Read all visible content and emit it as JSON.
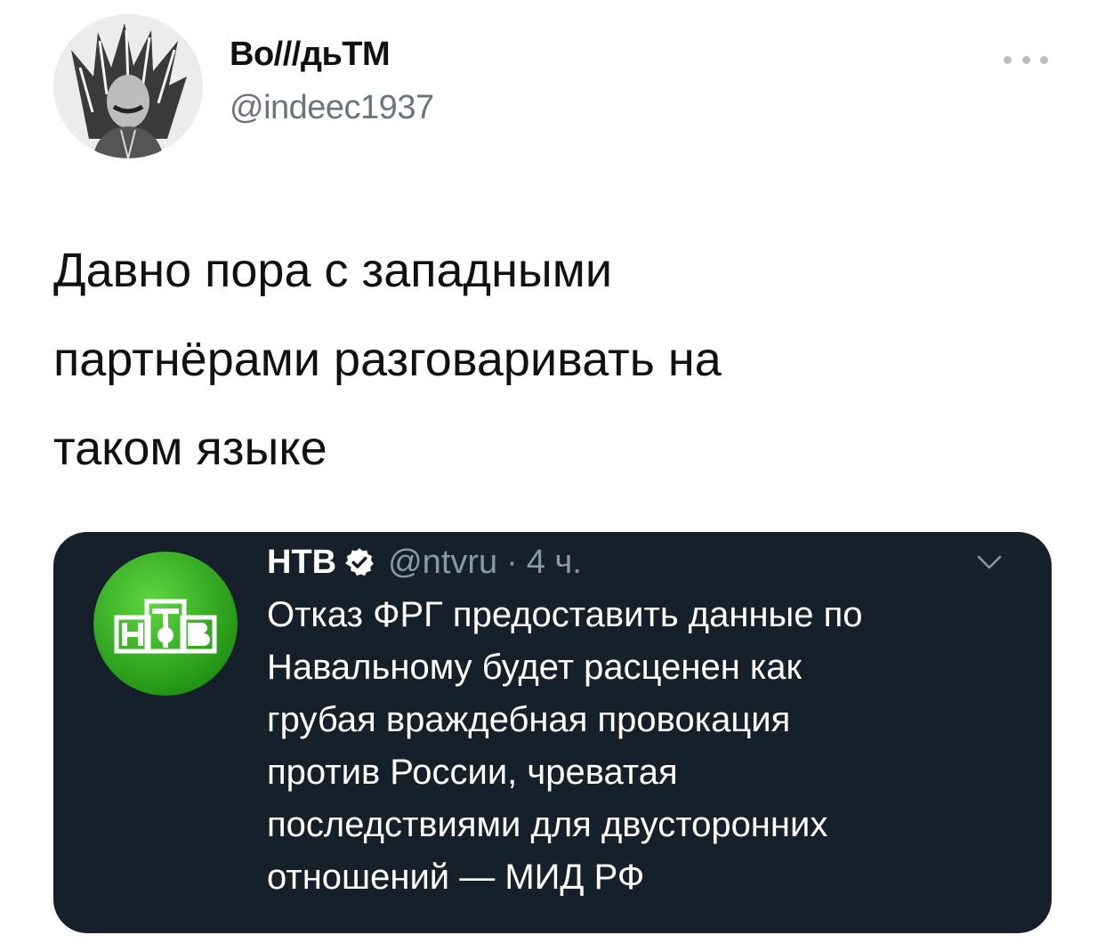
{
  "tweet": {
    "author": {
      "display_name": "Во///дьТМ",
      "handle": "@indeec1937",
      "avatar_icon": "portrait-avatar-icon"
    },
    "more_icon": "more-dots-icon",
    "text": "Давно пора с западными\nпартнёрами разговаривать на\nтаком языке"
  },
  "quoted_tweet": {
    "author": {
      "display_name": "НТВ",
      "verified_icon": "verified-badge-icon",
      "handle": "@ntvru",
      "separator": "·",
      "time": "4 ч.",
      "avatar_icon": "ntv-logo-icon"
    },
    "chevron_icon": "chevron-down-icon",
    "text": "Отказ ФРГ предоставить данные по\nНавальному будет расценен как\nгрубая враждебная провокация\nпротив России, чреватая\nпоследствиями для двусторонних\nотношений — МИД РФ"
  },
  "colors": {
    "card_background": "#16202a",
    "muted_text": "#8899a6",
    "ntv_green": "#2eaa1c"
  }
}
